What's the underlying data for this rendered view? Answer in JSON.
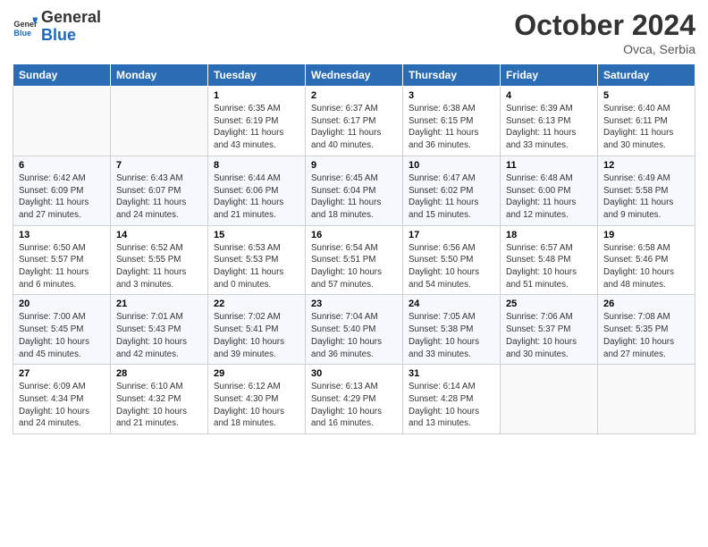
{
  "header": {
    "logo_general": "General",
    "logo_blue": "Blue",
    "month_title": "October 2024",
    "location": "Ovca, Serbia"
  },
  "days_of_week": [
    "Sunday",
    "Monday",
    "Tuesday",
    "Wednesday",
    "Thursday",
    "Friday",
    "Saturday"
  ],
  "weeks": [
    [
      {
        "num": "",
        "info": ""
      },
      {
        "num": "",
        "info": ""
      },
      {
        "num": "1",
        "info": "Sunrise: 6:35 AM\nSunset: 6:19 PM\nDaylight: 11 hours and 43 minutes."
      },
      {
        "num": "2",
        "info": "Sunrise: 6:37 AM\nSunset: 6:17 PM\nDaylight: 11 hours and 40 minutes."
      },
      {
        "num": "3",
        "info": "Sunrise: 6:38 AM\nSunset: 6:15 PM\nDaylight: 11 hours and 36 minutes."
      },
      {
        "num": "4",
        "info": "Sunrise: 6:39 AM\nSunset: 6:13 PM\nDaylight: 11 hours and 33 minutes."
      },
      {
        "num": "5",
        "info": "Sunrise: 6:40 AM\nSunset: 6:11 PM\nDaylight: 11 hours and 30 minutes."
      }
    ],
    [
      {
        "num": "6",
        "info": "Sunrise: 6:42 AM\nSunset: 6:09 PM\nDaylight: 11 hours and 27 minutes."
      },
      {
        "num": "7",
        "info": "Sunrise: 6:43 AM\nSunset: 6:07 PM\nDaylight: 11 hours and 24 minutes."
      },
      {
        "num": "8",
        "info": "Sunrise: 6:44 AM\nSunset: 6:06 PM\nDaylight: 11 hours and 21 minutes."
      },
      {
        "num": "9",
        "info": "Sunrise: 6:45 AM\nSunset: 6:04 PM\nDaylight: 11 hours and 18 minutes."
      },
      {
        "num": "10",
        "info": "Sunrise: 6:47 AM\nSunset: 6:02 PM\nDaylight: 11 hours and 15 minutes."
      },
      {
        "num": "11",
        "info": "Sunrise: 6:48 AM\nSunset: 6:00 PM\nDaylight: 11 hours and 12 minutes."
      },
      {
        "num": "12",
        "info": "Sunrise: 6:49 AM\nSunset: 5:58 PM\nDaylight: 11 hours and 9 minutes."
      }
    ],
    [
      {
        "num": "13",
        "info": "Sunrise: 6:50 AM\nSunset: 5:57 PM\nDaylight: 11 hours and 6 minutes."
      },
      {
        "num": "14",
        "info": "Sunrise: 6:52 AM\nSunset: 5:55 PM\nDaylight: 11 hours and 3 minutes."
      },
      {
        "num": "15",
        "info": "Sunrise: 6:53 AM\nSunset: 5:53 PM\nDaylight: 11 hours and 0 minutes."
      },
      {
        "num": "16",
        "info": "Sunrise: 6:54 AM\nSunset: 5:51 PM\nDaylight: 10 hours and 57 minutes."
      },
      {
        "num": "17",
        "info": "Sunrise: 6:56 AM\nSunset: 5:50 PM\nDaylight: 10 hours and 54 minutes."
      },
      {
        "num": "18",
        "info": "Sunrise: 6:57 AM\nSunset: 5:48 PM\nDaylight: 10 hours and 51 minutes."
      },
      {
        "num": "19",
        "info": "Sunrise: 6:58 AM\nSunset: 5:46 PM\nDaylight: 10 hours and 48 minutes."
      }
    ],
    [
      {
        "num": "20",
        "info": "Sunrise: 7:00 AM\nSunset: 5:45 PM\nDaylight: 10 hours and 45 minutes."
      },
      {
        "num": "21",
        "info": "Sunrise: 7:01 AM\nSunset: 5:43 PM\nDaylight: 10 hours and 42 minutes."
      },
      {
        "num": "22",
        "info": "Sunrise: 7:02 AM\nSunset: 5:41 PM\nDaylight: 10 hours and 39 minutes."
      },
      {
        "num": "23",
        "info": "Sunrise: 7:04 AM\nSunset: 5:40 PM\nDaylight: 10 hours and 36 minutes."
      },
      {
        "num": "24",
        "info": "Sunrise: 7:05 AM\nSunset: 5:38 PM\nDaylight: 10 hours and 33 minutes."
      },
      {
        "num": "25",
        "info": "Sunrise: 7:06 AM\nSunset: 5:37 PM\nDaylight: 10 hours and 30 minutes."
      },
      {
        "num": "26",
        "info": "Sunrise: 7:08 AM\nSunset: 5:35 PM\nDaylight: 10 hours and 27 minutes."
      }
    ],
    [
      {
        "num": "27",
        "info": "Sunrise: 6:09 AM\nSunset: 4:34 PM\nDaylight: 10 hours and 24 minutes."
      },
      {
        "num": "28",
        "info": "Sunrise: 6:10 AM\nSunset: 4:32 PM\nDaylight: 10 hours and 21 minutes."
      },
      {
        "num": "29",
        "info": "Sunrise: 6:12 AM\nSunset: 4:30 PM\nDaylight: 10 hours and 18 minutes."
      },
      {
        "num": "30",
        "info": "Sunrise: 6:13 AM\nSunset: 4:29 PM\nDaylight: 10 hours and 16 minutes."
      },
      {
        "num": "31",
        "info": "Sunrise: 6:14 AM\nSunset: 4:28 PM\nDaylight: 10 hours and 13 minutes."
      },
      {
        "num": "",
        "info": ""
      },
      {
        "num": "",
        "info": ""
      }
    ]
  ]
}
